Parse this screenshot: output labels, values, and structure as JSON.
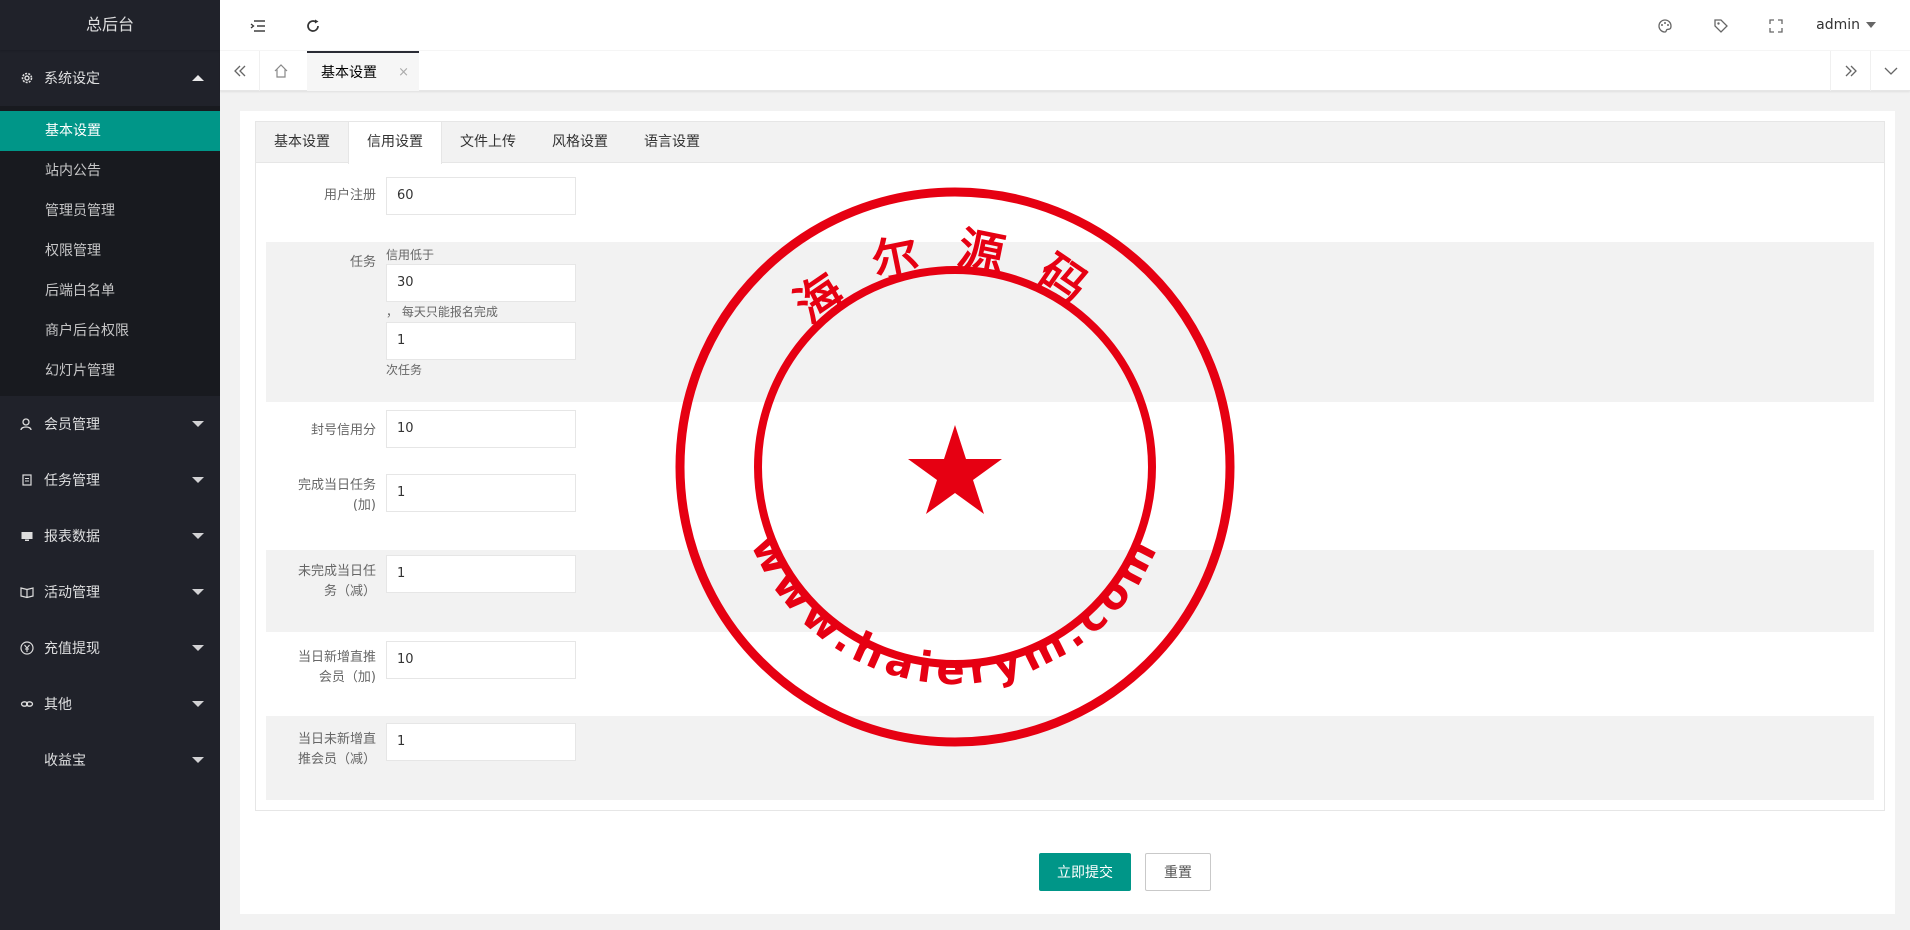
{
  "sidebar": {
    "logo": "总后台",
    "groups": [
      {
        "label": "系统设定",
        "icon": "gear-icon",
        "expanded": true,
        "items": [
          "基本设置",
          "站内公告",
          "管理员管理",
          "权限管理",
          "后端白名单",
          "商户后台权限",
          "幻灯片管理"
        ],
        "active_item": "基本设置"
      },
      {
        "label": "会员管理",
        "icon": "user-icon"
      },
      {
        "label": "任务管理",
        "icon": "document-icon"
      },
      {
        "label": "报表数据",
        "icon": "monitor-icon"
      },
      {
        "label": "活动管理",
        "icon": "book-icon"
      },
      {
        "label": "充值提现",
        "icon": "yen-icon"
      },
      {
        "label": "其他",
        "icon": "link-icon"
      },
      {
        "label": "收益宝",
        "icon": ""
      }
    ]
  },
  "header": {
    "user": "admin",
    "icons": [
      "menu-toggle-icon",
      "refresh-icon",
      "palette-icon",
      "tag-icon",
      "fullscreen-icon"
    ]
  },
  "page_tabs": {
    "current": "基本设置",
    "close": "×"
  },
  "settings_tabs": {
    "tabs": [
      "基本设置",
      "信用设置",
      "文件上传",
      "风格设置",
      "语言设置"
    ],
    "active": "信用设置"
  },
  "form": {
    "user_register": {
      "label": "用户注册",
      "value": "60"
    },
    "task": {
      "label": "任务",
      "hint_before": "信用低于",
      "threshold": "30",
      "hint_middle": "， 每天只能报名完成",
      "count": "1",
      "hint_after": "次任务"
    },
    "ban_credit": {
      "label": "封号信用分",
      "value": "10"
    },
    "complete_daily": {
      "label_1": "完成当日任务",
      "label_2": "(加)",
      "value": "1"
    },
    "incomplete_daily": {
      "label_1": "未完成当日任",
      "label_2": "务（减）",
      "value": "1"
    },
    "new_referral": {
      "label_1": "当日新增直推",
      "label_2": "会员（加)",
      "value": "10"
    },
    "no_new_referral": {
      "label_1": "当日未新增直",
      "label_2": "推会员（减）",
      "value": "1"
    }
  },
  "buttons": {
    "submit": "立即提交",
    "reset": "重置"
  },
  "watermark": {
    "top_text": "海尔源码",
    "bottom_text": "www.haierym.com",
    "color": "#e60012"
  },
  "colors": {
    "accent": "#009688",
    "sidebar_bg": "#20222a",
    "submenu_bg": "#181a1f"
  }
}
